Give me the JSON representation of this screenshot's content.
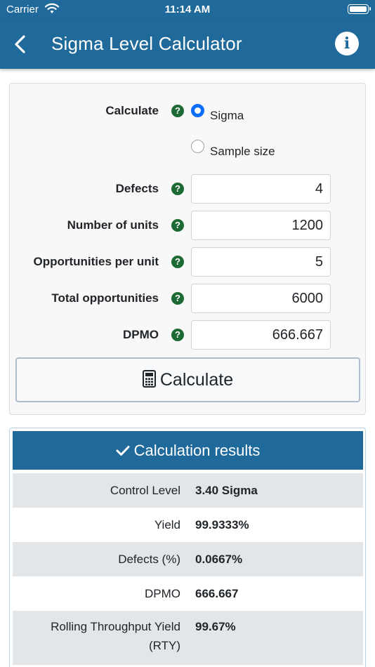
{
  "status_bar": {
    "carrier": "Carrier",
    "time": "11:14 AM"
  },
  "header": {
    "title": "Sigma Level Calculator"
  },
  "form": {
    "calculate_label": "Calculate",
    "options": [
      "Sigma",
      "Sample size"
    ],
    "selected_option": "Sigma",
    "fields": {
      "defects": {
        "label": "Defects",
        "value": "4"
      },
      "units": {
        "label": "Number of units",
        "value": "1200"
      },
      "opportunities": {
        "label": "Opportunities per unit",
        "value": "5"
      },
      "total": {
        "label": "Total opportunities",
        "value": "6000"
      },
      "dpmo": {
        "label": "DPMO",
        "value": "666.667"
      }
    },
    "help_glyph": "?",
    "calculate_button": "Calculate"
  },
  "results": {
    "title": "Calculation results",
    "rows": [
      {
        "label": "Control Level",
        "value": "3.40 Sigma"
      },
      {
        "label": "Yield",
        "value": "99.9333%"
      },
      {
        "label": "Defects (%)",
        "value": "0.0667%"
      },
      {
        "label": "DPMO",
        "value": "666.667"
      },
      {
        "label": "Rolling Throughput Yield",
        "label_line2": "(RTY)",
        "value": "99.67%"
      }
    ]
  },
  "colors": {
    "primary": "#1f6a9a",
    "help_badge": "#1e6a35",
    "radio_selected": "#0d6efd",
    "row_shade": "#e3e6e9"
  },
  "icons": [
    "wifi-icon",
    "battery-icon",
    "back-chevron-icon",
    "info-icon",
    "help-icon",
    "calculator-icon",
    "checkmark-icon"
  ]
}
